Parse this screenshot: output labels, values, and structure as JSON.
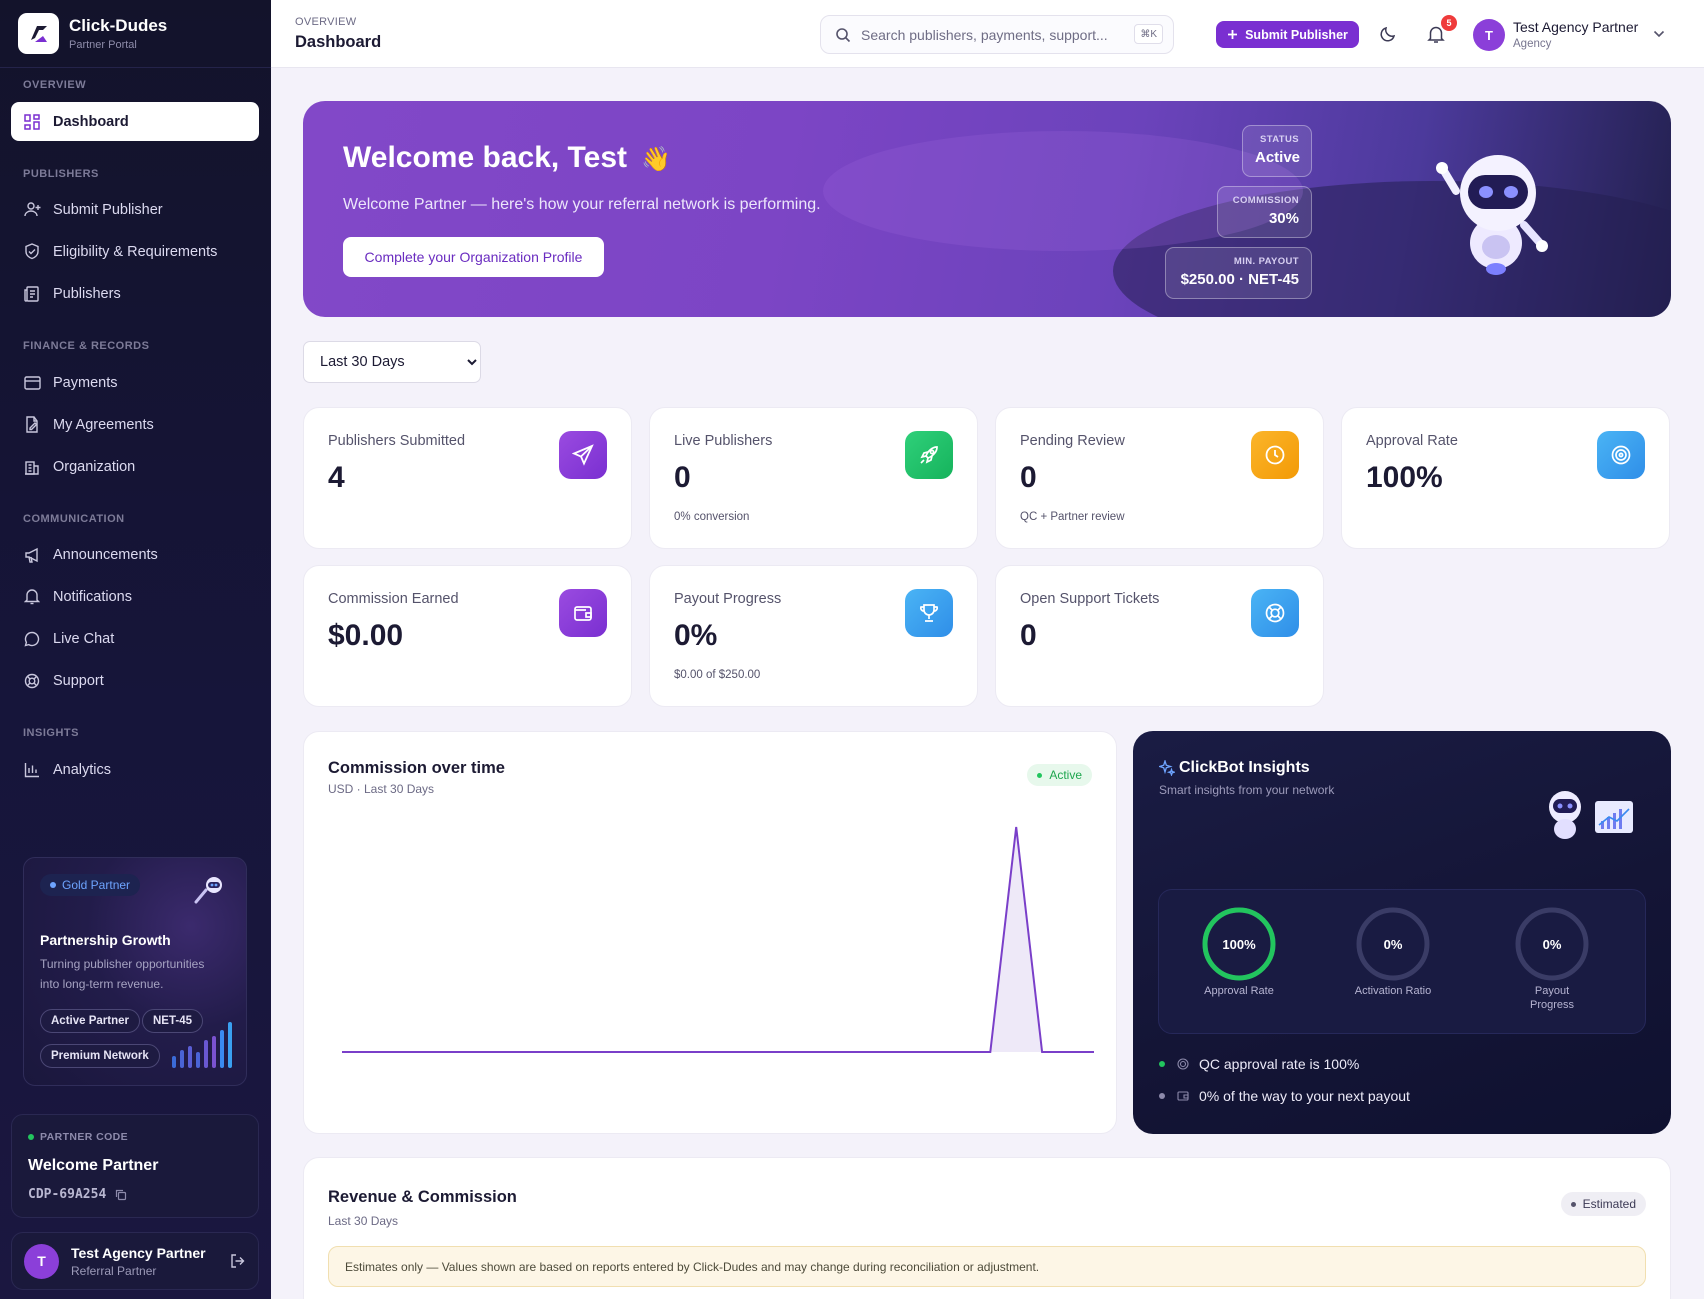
{
  "brand": {
    "name": "Click-Dudes",
    "subtitle": "Partner Portal"
  },
  "sidebar": {
    "sections": {
      "overview": "OVERVIEW",
      "publishers": "PUBLISHERS",
      "finance": "FINANCE & RECORDS",
      "communication": "COMMUNICATION",
      "insights": "INSIGHTS"
    },
    "items": {
      "dashboard": "Dashboard",
      "submit_publisher": "Submit Publisher",
      "eligibility": "Eligibility & Requirements",
      "publishers": "Publishers",
      "payments": "Payments",
      "agreements": "My Agreements",
      "organization": "Organization",
      "announcements": "Announcements",
      "notifications": "Notifications",
      "live_chat": "Live Chat",
      "support": "Support",
      "analytics": "Analytics"
    },
    "promo": {
      "badge": "Gold Partner",
      "title": "Partnership Growth",
      "text": "Turning publisher opportunities into long-term revenue.",
      "tags": [
        "Active Partner",
        "NET-45",
        "Premium Network"
      ]
    },
    "partner_code": {
      "label": "PARTNER CODE",
      "name": "Welcome Partner",
      "code": "CDP-69A254"
    },
    "user": {
      "initial": "T",
      "name": "Test Agency Partner",
      "role": "Referral Partner"
    }
  },
  "header": {
    "breadcrumb": "OVERVIEW",
    "title": "Dashboard",
    "search_placeholder": "Search publishers, payments, support...",
    "search_shortcut": "⌘K",
    "submit_label": "Submit Publisher",
    "notification_count": "5",
    "user": {
      "initial": "T",
      "name": "Test Agency Partner",
      "role": "Agency"
    }
  },
  "hero": {
    "title": "Welcome back, Test",
    "emoji": "👋",
    "subtitle": "Welcome Partner — here's how your referral network is performing.",
    "cta": "Complete your Organization Profile",
    "status_label": "STATUS",
    "status_value": "Active",
    "commission_label": "COMMISSION",
    "commission_value": "30%",
    "payout_label": "MIN. PAYOUT",
    "payout_value": "$250.00 · NET-45"
  },
  "period": {
    "selected": "Last 30 Days"
  },
  "stats": {
    "publishers_submitted": {
      "label": "Publishers Submitted",
      "value": "4"
    },
    "live_publishers": {
      "label": "Live Publishers",
      "value": "0",
      "sub": "0% conversion"
    },
    "pending_review": {
      "label": "Pending Review",
      "value": "0",
      "sub": "QC + Partner review"
    },
    "approval_rate": {
      "label": "Approval Rate",
      "value": "100%"
    },
    "commission_earned": {
      "label": "Commission Earned",
      "value": "$0.00"
    },
    "payout_progress": {
      "label": "Payout Progress",
      "value": "0%",
      "sub": "$0.00 of $250.00"
    },
    "support_tickets": {
      "label": "Open Support Tickets",
      "value": "0"
    }
  },
  "colors": {
    "accent": "#7a2fd1",
    "green": "#22c55e",
    "amber": "#f5a70a",
    "blue": "#3aa0f0"
  },
  "commission_chart": {
    "title": "Commission over time",
    "subtitle": "USD · Last 30 Days",
    "badge": "Active"
  },
  "chart_data": {
    "type": "area",
    "x": [
      1,
      2,
      3,
      4,
      5,
      6,
      7,
      8,
      9,
      10,
      11,
      12,
      13,
      14,
      15,
      16,
      17,
      18,
      19,
      20,
      21,
      22,
      23,
      24,
      25,
      26,
      27,
      28,
      29,
      30
    ],
    "series": [
      {
        "values": [
          0,
          0,
          0,
          0,
          0,
          0,
          0,
          0,
          0,
          0,
          0,
          0,
          0,
          0,
          0,
          0,
          0,
          0,
          0,
          0,
          0,
          0,
          0,
          0,
          0,
          0,
          1,
          0,
          0,
          0
        ]
      }
    ],
    "ylim": [
      0,
      1
    ],
    "grid": false
  },
  "insights": {
    "title": "ClickBot Insights",
    "subtitle": "Smart insights from your network",
    "rings": [
      {
        "value": "100%",
        "label": "Approval Rate",
        "fraction": 1.0,
        "color": "#22c55e"
      },
      {
        "value": "0%",
        "label": "Activation Ratio",
        "fraction": 0,
        "color": "#3a3c66"
      },
      {
        "value": "0%",
        "label": "Payout Progress",
        "fraction": 0,
        "color": "#3a3c66"
      }
    ],
    "lines": [
      "QC approval rate is 100%",
      "0% of the way to your next payout"
    ]
  },
  "revenue": {
    "title": "Revenue & Commission",
    "subtitle": "Last 30 Days",
    "badge": "Estimated",
    "notice": "Estimates only — Values shown are based on reports entered by Click-Dudes and may change during reconciliation or adjustment."
  }
}
